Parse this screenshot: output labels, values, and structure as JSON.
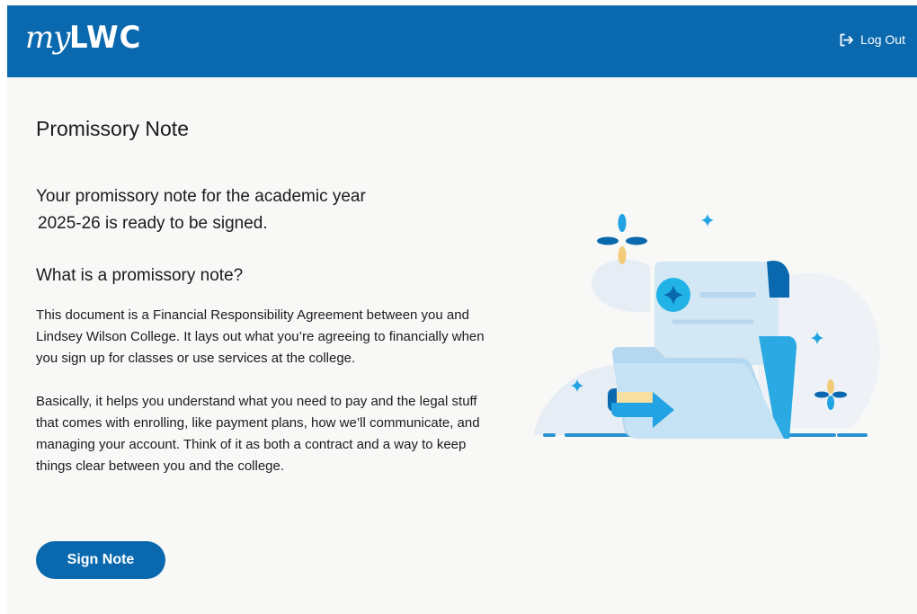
{
  "header": {
    "logo_prefix": "my",
    "logo_suffix": "LWC",
    "logout_label": "Log Out",
    "logout_icon": "logout-icon",
    "brand_color": "#0a69ae"
  },
  "main": {
    "title": "Promissory Note",
    "lead_line1": "Your promissory note for the academic year",
    "lead_line2": "2025-26 is ready to be signed.",
    "question": "What is a promissory note?",
    "paragraph1": "This document is a Financial Responsibility Agreement between you and Lindsey Wilson College. It lays out what you’re agreeing to financially when you sign up for classes or use services at the college.",
    "paragraph2": "Basically, it helps you understand what you need to pay and the legal stuff that comes with enrolling, like payment plans, how we’ll communicate, and managing your account. Think of it as both a contract and a way to keep things clear between you and the college.",
    "sign_button": "Sign Note"
  }
}
